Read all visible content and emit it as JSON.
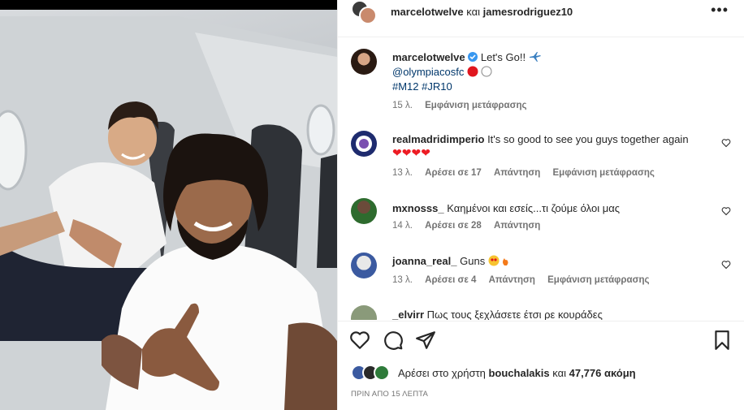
{
  "header": {
    "user1": "marcelotwelve",
    "conj": "και",
    "user2": "jamesrodriguez10",
    "more": "•••"
  },
  "caption": {
    "username": "marcelotwelve",
    "text": "Let's Go!!",
    "mention": "@olympiacosfc",
    "hashtags": "#M12 #JR10",
    "time": "15 λ.",
    "translate": "Εμφάνιση μετάφρασης"
  },
  "comments": [
    {
      "username": "realmadridimperio",
      "text": "It's so good to see you guys together again",
      "hearts": "❤❤❤❤",
      "time": "13 λ.",
      "likes": "Αρέσει σε 17",
      "reply": "Απάντηση",
      "translate": "Εμφάνιση μετάφρασης"
    },
    {
      "username": "mxnosss_",
      "text": "Καημένοι και εσείς...τι ζούμε όλοι μας",
      "time": "14 λ.",
      "likes": "Αρέσει σε 28",
      "reply": "Απάντηση"
    },
    {
      "username": "joanna_real_",
      "text": "Guns",
      "time": "13 λ.",
      "likes": "Αρέσει σε 4",
      "reply": "Απάντηση",
      "translate": "Εμφάνιση μετάφρασης"
    },
    {
      "username": "_elvirr",
      "text": "Πως τους ξεχλάσετε έτσι ρε κουράδες"
    }
  ],
  "likes_line": {
    "prefix": "Αρέσει στο χρήστη",
    "user": "bouchalakis",
    "conj": "και",
    "count": "47,776 ακόμη"
  },
  "timestamp": "ΠΡΙΝ ΑΠΟ 15 ΛΕΠΤΑ",
  "colors": {
    "link": "#00376b",
    "verified": "#3897f0",
    "muted": "#737373"
  }
}
